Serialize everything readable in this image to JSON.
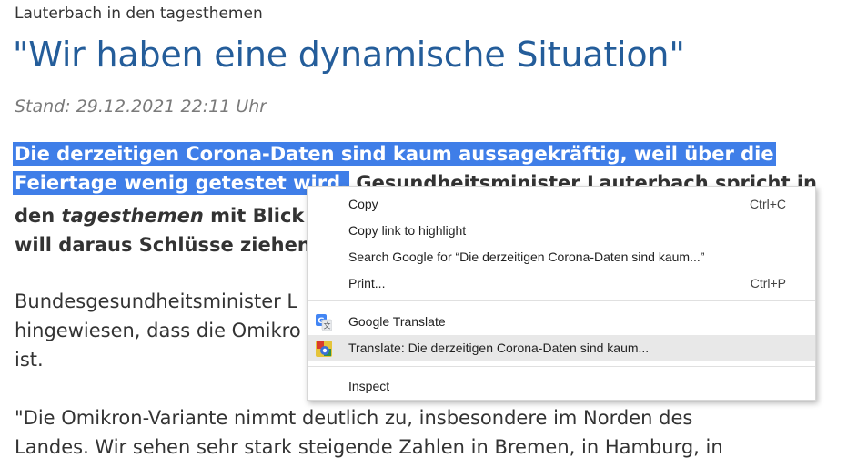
{
  "article": {
    "kicker": "Lauterbach in den tagesthemen",
    "headline": "\"Wir haben eine dynamische Situation\"",
    "stand": "Stand: 29.12.2021 22:11 Uhr",
    "teaser": {
      "line1_selected": "Die derzeitigen Corona-Daten sind kaum aussagekräftig, weil über die",
      "line2_selected": "Feiertage wenig getestet wird.",
      "line2_rest": " Gesundheitsminister Lauterbach spricht in",
      "line3_a": "den ",
      "line3_italic": "tagesthemen",
      "line3_b": " mit Blick au",
      "line4": "will daraus Schlüsse ziehen."
    },
    "para1": {
      "line1": "Bundesgesundheitsminister L",
      "line2": "hingewiesen, dass die Omikro",
      "line3": "ist."
    },
    "para2": {
      "line1": "\"Die Omikron-Variante nimmt deutlich zu, insbesondere im Norden des",
      "line2": "Landes. Wir sehen sehr stark steigende Zahlen in Bremen, in Hamburg, in"
    }
  },
  "context_menu": {
    "items": [
      {
        "label": "Copy",
        "shortcut": "Ctrl+C"
      },
      {
        "label": "Copy link to highlight",
        "shortcut": ""
      },
      {
        "label": "Search Google for “Die derzeitigen Corona-Daten sind kaum...”",
        "shortcut": ""
      },
      {
        "label": "Print...",
        "shortcut": "Ctrl+P"
      },
      {
        "label": "Google Translate",
        "icon": "google-translate-icon"
      },
      {
        "label": "Translate: Die derzeitigen Corona-Daten sind kaum...",
        "icon": "translate-extension-icon"
      },
      {
        "label": "Inspect",
        "shortcut": ""
      }
    ]
  },
  "colors": {
    "headline": "#245d9a",
    "selection": "#3f7ee8",
    "menu_hover": "#e8e8e8"
  }
}
